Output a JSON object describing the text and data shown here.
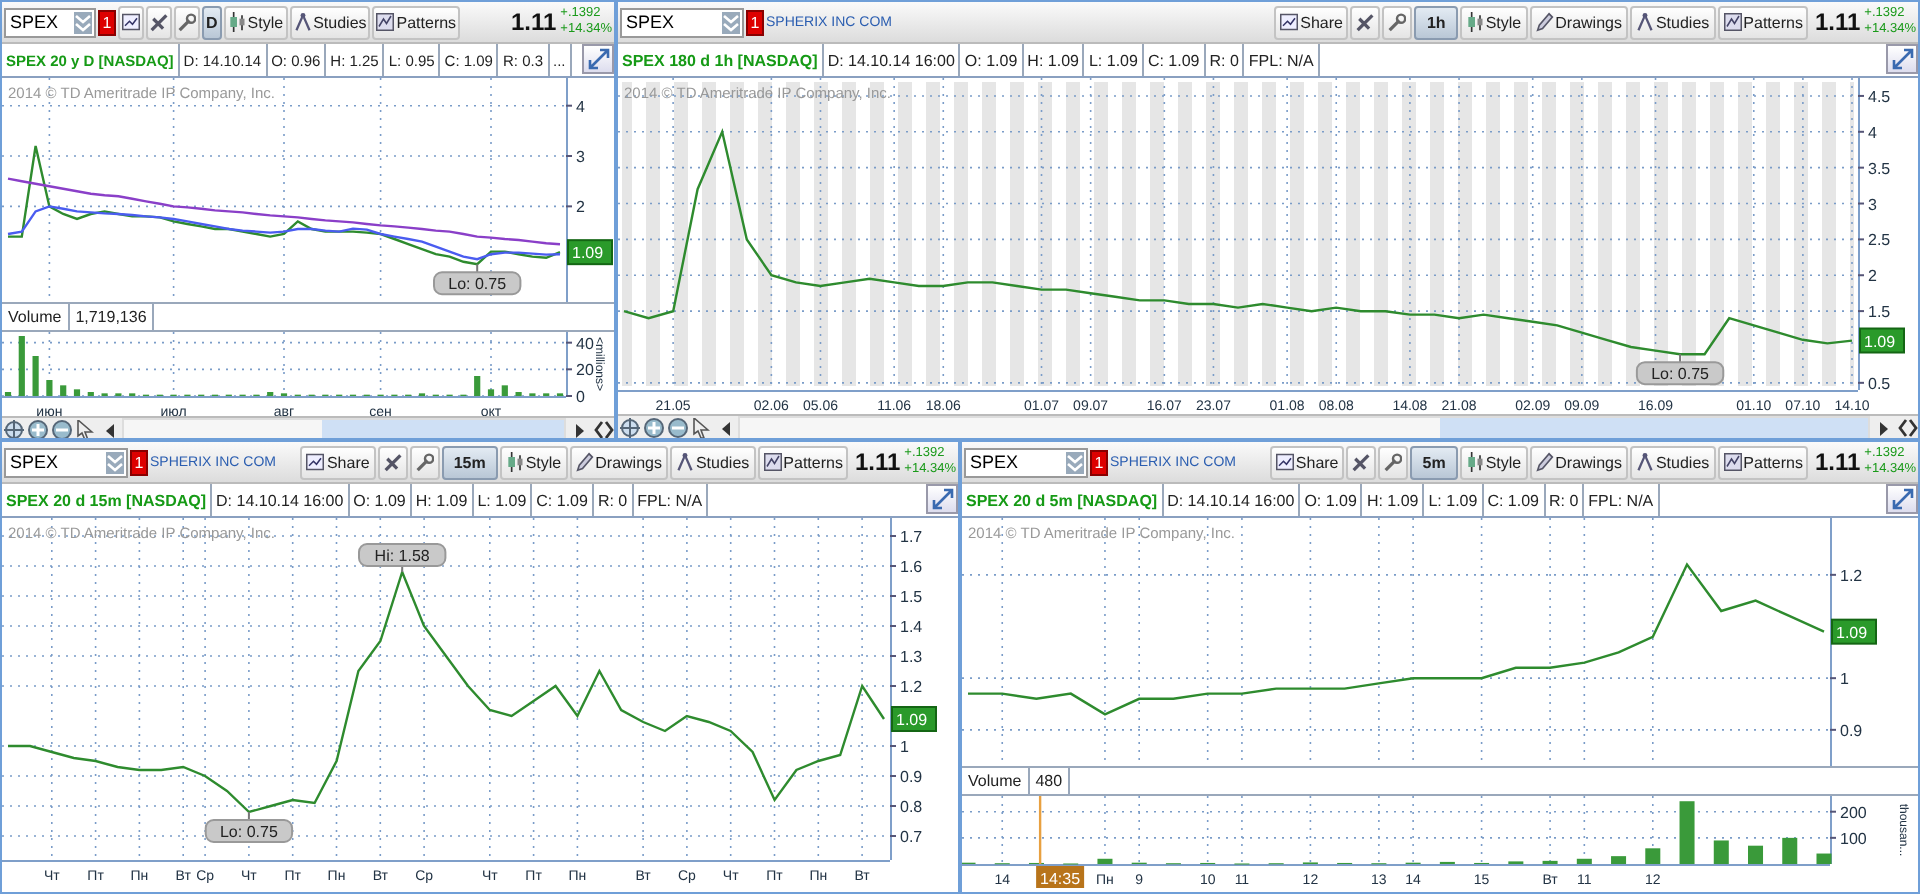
{
  "panels": [
    {
      "toolbar": {
        "symbol": "SPEX",
        "alert": "1",
        "tools": [
          {
            "kind": "share"
          },
          {
            "kind": "drawing_tools"
          },
          {
            "kind": "timeframe",
            "label": "D"
          },
          {
            "kind": "style",
            "label": "Style"
          },
          {
            "kind": "studies",
            "label": "Studies"
          },
          {
            "kind": "patterns",
            "label": "Patterns"
          }
        ],
        "quote": {
          "last": "1.11",
          "change": "+.1392",
          "change_pct": "+14.34%"
        }
      },
      "info": {
        "title": "SPEX 20 y D [NASDAQ]",
        "fields": [
          "D: 14.10.14",
          "O: 0.96",
          "H: 1.25",
          "L: 0.95",
          "C: 1.09",
          "R: 0.3",
          "..."
        ]
      },
      "copyright": "2014 © TD Ameritrade IP Company, Inc.",
      "price_chart": {
        "price_label": "1.09",
        "chart_data": {
          "type": "line",
          "grid": true,
          "ylim": [
            0.1,
            4.55
          ],
          "yticks": [
            2,
            3,
            4
          ],
          "series": [
            {
              "color": "#2e8b2e",
              "values": [
                1.4,
                1.4,
                3.2,
                2.0,
                1.85,
                1.75,
                1.85,
                1.9,
                1.85,
                1.8,
                1.8,
                1.78,
                1.7,
                1.65,
                1.6,
                1.55,
                1.55,
                1.5,
                1.45,
                1.4,
                1.45,
                1.7,
                1.55,
                1.5,
                1.5,
                1.5,
                1.48,
                1.45,
                1.35,
                1.25,
                1.15,
                1.05,
                1.0,
                0.9,
                0.85,
                1.1,
                1.1,
                1.05,
                1.0,
                0.98,
                1.09
              ]
            },
            {
              "color": "#8a3fc8",
              "values": [
                2.55,
                2.5,
                2.45,
                2.4,
                2.35,
                2.3,
                2.25,
                2.22,
                2.2,
                2.15,
                2.1,
                2.05,
                2.0,
                1.98,
                1.95,
                1.92,
                1.9,
                1.88,
                1.85,
                1.82,
                1.8,
                1.78,
                1.75,
                1.72,
                1.7,
                1.68,
                1.65,
                1.62,
                1.6,
                1.58,
                1.55,
                1.52,
                1.5,
                1.45,
                1.4,
                1.38,
                1.35,
                1.33,
                1.3,
                1.27,
                1.25
              ]
            },
            {
              "color": "#4a5cf0",
              "values": [
                1.45,
                1.5,
                1.9,
                2.0,
                1.95,
                1.9,
                1.88,
                1.86,
                1.85,
                1.83,
                1.8,
                1.78,
                1.75,
                1.7,
                1.65,
                1.6,
                1.55,
                1.52,
                1.5,
                1.48,
                1.5,
                1.55,
                1.55,
                1.52,
                1.5,
                1.56,
                1.54,
                1.45,
                1.4,
                1.35,
                1.3,
                1.2,
                1.1,
                1.0,
                0.95,
                1.05,
                1.08,
                1.08,
                1.06,
                1.04,
                1.05
              ]
            }
          ],
          "annotations": [
            "Lo: 0.75"
          ]
        }
      },
      "volume": {
        "label": "Volume",
        "value": "1,719,136",
        "chart_data": {
          "type": "bar",
          "grid": true,
          "ylim": [
            0,
            48
          ],
          "yticks": [
            0,
            20,
            40
          ],
          "ylabel": "<millions>",
          "categories": [
            null,
            null,
            null,
            "июн",
            null,
            null,
            null,
            null,
            null,
            null,
            null,
            null,
            "июл",
            null,
            null,
            null,
            null,
            null,
            null,
            null,
            "авг",
            null,
            null,
            null,
            null,
            null,
            null,
            "сен",
            null,
            null,
            null,
            null,
            null,
            null,
            null,
            "окт",
            null,
            null,
            null,
            null,
            null
          ],
          "series": [
            {
              "color": "#3a9a3a",
              "values": [
                3,
                45,
                30,
                12,
                8,
                5,
                3,
                2,
                2,
                2,
                1,
                1,
                1,
                1,
                1,
                1,
                1,
                1,
                1,
                3,
                2,
                1,
                1,
                1,
                1,
                1,
                1,
                1,
                1,
                1,
                2,
                1,
                1,
                1,
                15,
                5,
                8,
                3,
                2,
                2,
                2
              ]
            }
          ]
        }
      }
    },
    {
      "toolbar": {
        "symbol": "SPEX",
        "alert": "1",
        "company": "SPHERIX INC COM",
        "tools": [
          {
            "kind": "share",
            "label": "Share"
          },
          {
            "kind": "drawing_tools"
          },
          {
            "kind": "timeframe",
            "label": "1h"
          },
          {
            "kind": "style",
            "label": "Style"
          },
          {
            "kind": "drawings",
            "label": "Drawings"
          },
          {
            "kind": "studies",
            "label": "Studies"
          },
          {
            "kind": "patterns",
            "label": "Patterns"
          }
        ],
        "quote": {
          "last": "1.11",
          "change": "+.1392",
          "change_pct": "+14.34%"
        }
      },
      "info": {
        "title": "SPEX 180 d 1h [NASDAQ]",
        "fields": [
          "D: 14.10.14 16:00",
          "O: 1.09",
          "H: 1.09",
          "L: 1.09",
          "C: 1.09",
          "R: 0",
          "FPL: N/A"
        ]
      },
      "copyright": "2014 © TD Ameritrade IP Company, Inc.",
      "price_chart": {
        "price_label": "1.09",
        "chart_data": {
          "type": "line",
          "grid": true,
          "ylim": [
            0.4,
            4.75
          ],
          "yticks": [
            0.5,
            1.5,
            2,
            2.5,
            3,
            3.5,
            4,
            4.5
          ],
          "categories": [
            null,
            null,
            "21.05",
            null,
            null,
            null,
            "02.06",
            null,
            "05.06",
            null,
            null,
            "11.06",
            null,
            "18.06",
            null,
            null,
            null,
            "01.07",
            null,
            "09.07",
            null,
            null,
            "16.07",
            null,
            "23.07",
            null,
            null,
            "01.08",
            null,
            "08.08",
            null,
            null,
            "14.08",
            null,
            "21.08",
            null,
            null,
            "02.09",
            null,
            "09.09",
            null,
            null,
            "16.09",
            null,
            null,
            null,
            "01.10",
            null,
            "07.10",
            null,
            "14.10"
          ],
          "series": [
            {
              "color": "#2e8b2e",
              "values": [
                1.5,
                1.4,
                1.5,
                3.2,
                4.0,
                2.5,
                2.0,
                1.9,
                1.85,
                1.9,
                1.95,
                1.9,
                1.85,
                1.85,
                1.9,
                1.9,
                1.85,
                1.8,
                1.8,
                1.75,
                1.7,
                1.65,
                1.65,
                1.6,
                1.6,
                1.55,
                1.6,
                1.55,
                1.5,
                1.55,
                1.5,
                1.5,
                1.45,
                1.45,
                1.4,
                1.45,
                1.4,
                1.35,
                1.3,
                1.2,
                1.1,
                1.0,
                0.95,
                0.9,
                0.9,
                1.4,
                1.3,
                1.2,
                1.1,
                1.05,
                1.09
              ]
            }
          ],
          "annotations": [
            "Lo: 0.75"
          ]
        }
      }
    },
    {
      "toolbar": {
        "symbol": "SPEX",
        "alert": "1",
        "company": "SPHERIX INC COM",
        "tools": [
          {
            "kind": "share",
            "label": "Share"
          },
          {
            "kind": "drawing_tools"
          },
          {
            "kind": "timeframe",
            "label": "15m"
          },
          {
            "kind": "style",
            "label": "Style"
          },
          {
            "kind": "drawings",
            "label": "Drawings"
          },
          {
            "kind": "studies",
            "label": "Studies"
          },
          {
            "kind": "patterns",
            "label": "Patterns"
          }
        ],
        "quote": {
          "last": "1.11",
          "change": "+.1392",
          "change_pct": "+14.34%"
        }
      },
      "info": {
        "title": "SPEX 20 d 15m [NASDAQ]",
        "fields": [
          "D: 14.10.14 16:00",
          "O: 1.09",
          "H: 1.09",
          "L: 1.09",
          "C: 1.09",
          "R: 0",
          "FPL: N/A"
        ]
      },
      "copyright": "2014 © TD Ameritrade IP Company, Inc.",
      "price_chart": {
        "price_label": "1.09",
        "chart_data": {
          "type": "line",
          "grid": true,
          "ylim": [
            0.62,
            1.76
          ],
          "yticks": [
            0.7,
            0.8,
            0.9,
            1,
            1.2,
            1.3,
            1.4,
            1.5,
            1.6,
            1.7
          ],
          "categories": [
            null,
            null,
            "Чт",
            null,
            "Пт",
            null,
            "Пн",
            null,
            "Вт",
            "Ср",
            null,
            "Чт",
            null,
            "Пт",
            null,
            "Пн",
            null,
            "Вт",
            null,
            "Ср",
            null,
            null,
            "Чт",
            null,
            "Пт",
            null,
            "Пн",
            null,
            null,
            "Вт",
            null,
            "Ср",
            null,
            "Чт",
            null,
            "Пт",
            null,
            "Пн",
            null,
            "Вт",
            null
          ],
          "series": [
            {
              "color": "#2e8b2e",
              "values": [
                1.0,
                1.0,
                0.98,
                0.96,
                0.95,
                0.93,
                0.92,
                0.92,
                0.93,
                0.9,
                0.85,
                0.78,
                0.8,
                0.82,
                0.81,
                0.95,
                1.25,
                1.35,
                1.58,
                1.4,
                1.3,
                1.2,
                1.12,
                1.1,
                1.15,
                1.2,
                1.1,
                1.25,
                1.12,
                1.08,
                1.05,
                1.1,
                1.08,
                1.05,
                0.98,
                0.82,
                0.92,
                0.95,
                0.97,
                1.2,
                1.09
              ]
            }
          ],
          "annotations": [
            "Hi: 1.58",
            "Lo: 0.75"
          ]
        }
      }
    },
    {
      "toolbar": {
        "symbol": "SPEX",
        "alert": "1",
        "company": "SPHERIX INC COM",
        "tools": [
          {
            "kind": "share",
            "label": "Share"
          },
          {
            "kind": "drawing_tools"
          },
          {
            "kind": "timeframe",
            "label": "5m"
          },
          {
            "kind": "style",
            "label": "Style"
          },
          {
            "kind": "drawings",
            "label": "Drawings"
          },
          {
            "kind": "studies",
            "label": "Studies"
          },
          {
            "kind": "patterns",
            "label": "Patterns"
          }
        ],
        "quote": {
          "last": "1.11",
          "change": "+.1392",
          "change_pct": "+14.34%"
        }
      },
      "info": {
        "title": "SPEX 20 d 5m [NASDAQ]",
        "fields": [
          "D: 14.10.14 16:00",
          "O: 1.09",
          "H: 1.09",
          "L: 1.09",
          "C: 1.09",
          "R: 0",
          "FPL: N/A"
        ]
      },
      "copyright": "2014 © TD Ameritrade IP Company, Inc.",
      "price_chart": {
        "price_label": "1.09",
        "chart_data": {
          "type": "line",
          "grid": true,
          "ylim": [
            0.83,
            1.31
          ],
          "yticks": [
            0.9,
            1,
            1.2
          ],
          "series": [
            {
              "color": "#2e8b2e",
              "values": [
                0.97,
                0.97,
                0.96,
                0.97,
                0.93,
                0.96,
                0.96,
                0.97,
                0.97,
                0.98,
                0.98,
                0.98,
                0.99,
                1.0,
                1.0,
                1.0,
                1.02,
                1.02,
                1.03,
                1.05,
                1.08,
                1.22,
                1.13,
                1.15,
                1.12,
                1.09
              ]
            }
          ]
        }
      },
      "volume": {
        "label": "Volume",
        "value": "480",
        "cursor_label": "14:35",
        "chart_data": {
          "type": "bar",
          "grid": true,
          "ylim": [
            0,
            260
          ],
          "yticks": [
            100,
            200
          ],
          "ylabel": "thousan...",
          "categories": [
            null,
            "14",
            null,
            null,
            "Пн",
            "9",
            null,
            "10",
            "11",
            null,
            "12",
            null,
            "13",
            "14",
            null,
            "15",
            null,
            "Вт",
            "11",
            null,
            "12",
            null,
            null,
            null,
            null,
            null
          ],
          "series": [
            {
              "color": "#3a9a3a",
              "values": [
                5,
                3,
                4,
                2,
                20,
                5,
                3,
                4,
                2,
                3,
                6,
                4,
                3,
                5,
                8,
                4,
                10,
                12,
                20,
                30,
                60,
                240,
                90,
                70,
                100,
                40
              ]
            }
          ]
        }
      }
    }
  ]
}
